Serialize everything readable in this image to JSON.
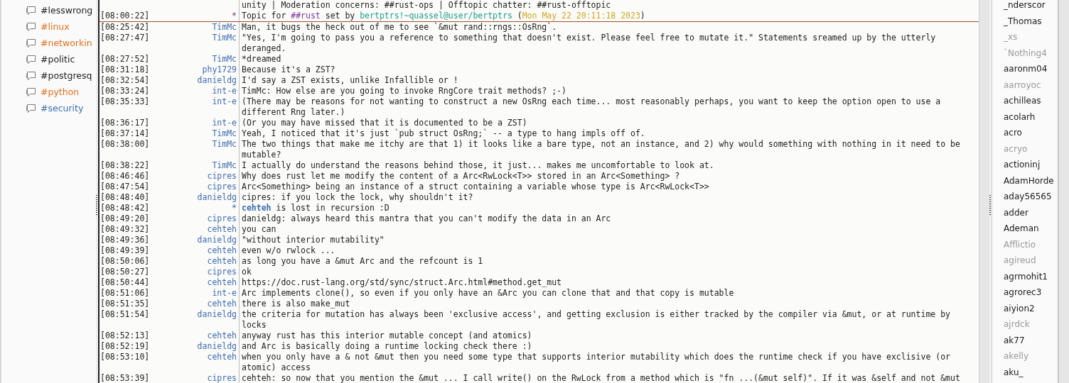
{
  "channels": [
    {
      "name": "#lesswrong",
      "color": "#1e1e1e"
    },
    {
      "name": "#linux",
      "color": "#e0701c"
    },
    {
      "name": "#networkin",
      "color": "#e0701c"
    },
    {
      "name": "#politic",
      "color": "#1e1e1e"
    },
    {
      "name": "#postgresq",
      "color": "#1e1e1e"
    },
    {
      "name": "#python",
      "color": "#e0701c"
    },
    {
      "name": "#security",
      "color": "#3a70b0"
    }
  ],
  "messages": [
    {
      "kind": "continuation",
      "text": "unity | Moderation concerns: ##rust-ops | Offtopic chatter: ##rust-offtopic"
    },
    {
      "kind": "topic",
      "time": "[08:00:22]",
      "sender": "*",
      "read_marker": true,
      "parts": [
        {
          "kind": "plain",
          "text": "Topic for "
        },
        {
          "kind": "channel",
          "text": "##rust"
        },
        {
          "kind": "plain",
          "text": " set by "
        },
        {
          "kind": "host",
          "text": "bertptrs!~quassel@user/bertptrs"
        },
        {
          "kind": "plain",
          "text": " ("
        },
        {
          "kind": "date",
          "text": "Mon May 22 20:11:18 2023"
        },
        {
          "kind": "plain",
          "text": ")"
        }
      ]
    },
    {
      "kind": "message",
      "time": "[08:25:42]",
      "sender": "TimMc",
      "text": "Man, it bugs the heck out of me to see `&mut rand::rngs::OsRng`."
    },
    {
      "kind": "message",
      "time": "[08:27:47]",
      "sender": "TimMc",
      "text": "\"Yes, I'm going to pass you a reference to something that doesn't exist. Please feel free to mutate it.\" Statements sreamed up by the utterly deranged."
    },
    {
      "kind": "message",
      "time": "[08:27:52]",
      "sender": "TimMc",
      "text": "*dreamed"
    },
    {
      "kind": "message",
      "time": "[08:31:18]",
      "sender": "phy1729",
      "text": "Because it's a ZST?"
    },
    {
      "kind": "message",
      "time": "[08:32:54]",
      "sender": "danieldg",
      "text": "I'd say a ZST exists, unlike Infallible or !"
    },
    {
      "kind": "message",
      "time": "[08:33:24]",
      "sender": "int-e",
      "text": "TimMc: How else are you going to invoke RngCore trait methods? ;-)"
    },
    {
      "kind": "message",
      "time": "[08:35:33]",
      "sender": "int-e",
      "text": "(There may be reasons for not wanting to construct a new OsRng each time... most reasonably perhaps, you want to keep the option open to use a different Rng later.)"
    },
    {
      "kind": "message",
      "time": "[08:36:17]",
      "sender": "int-e",
      "text": "(Or you may have missed that it is documented to be a ZST)"
    },
    {
      "kind": "message",
      "time": "[08:37:14]",
      "sender": "TimMc",
      "text": "Yeah, I noticed that it's just `pub struct OsRng;` -- a type to hang impls off of."
    },
    {
      "kind": "message",
      "time": "[08:38:00]",
      "sender": "TimMc",
      "text": "The two things that make me itchy are that 1) it looks like a bare type, not an instance, and 2) why would something with nothing in it need to be mutable?"
    },
    {
      "kind": "message",
      "time": "[08:38:22]",
      "sender": "TimMc",
      "text": "I actually do understand the reasons behind those, it just... makes me uncomfortable to look at."
    },
    {
      "kind": "message",
      "time": "[08:46:46]",
      "sender": "cipres",
      "text": "Why does rust let me modify the content of a Arc<RwLock<T>> stored in an Arc<Something> ?"
    },
    {
      "kind": "message",
      "time": "[08:47:54]",
      "sender": "cipres",
      "text": "Arc<Something> being an instance of a struct containing a variable whose type is Arc<RwLock<T>>"
    },
    {
      "kind": "message",
      "time": "[08:48:40]",
      "sender": "danieldg",
      "text": "cipres: if you lock the lock, why shouldn't it?"
    },
    {
      "kind": "action",
      "time": "[08:48:42]",
      "sender": "*",
      "parts": [
        {
          "kind": "nick",
          "text": "cehteh"
        },
        {
          "kind": "plain",
          "text": " is lost in recursion :D"
        }
      ]
    },
    {
      "kind": "message",
      "time": "[08:49:20]",
      "sender": "cipres",
      "text": "danieldg: always heard this mantra that you can't modify the data in an Arc"
    },
    {
      "kind": "message",
      "time": "[08:49:32]",
      "sender": "cehteh",
      "text": "you can"
    },
    {
      "kind": "message",
      "time": "[08:49:36]",
      "sender": "danieldg",
      "text": "\"without interior mutability\""
    },
    {
      "kind": "message",
      "time": "[08:49:39]",
      "sender": "cehteh",
      "text": "even w/o rwlock ..."
    },
    {
      "kind": "message",
      "time": "[08:50:06]",
      "sender": "cehteh",
      "text": "as long you have a &mut Arc and the refcount is 1"
    },
    {
      "kind": "message",
      "time": "[08:50:27]",
      "sender": "cipres",
      "text": "ok"
    },
    {
      "kind": "message",
      "time": "[08:50:44]",
      "sender": "cehteh",
      "text": "https://doc.rust-lang.org/std/sync/struct.Arc.html#method.get_mut"
    },
    {
      "kind": "message",
      "time": "[08:51:06]",
      "sender": "int-e",
      "text": "Arc implements clone(), so even if you only have an &Arc you can clone that and that copy is mutable"
    },
    {
      "kind": "message",
      "time": "[08:51:35]",
      "sender": "cehteh",
      "text": "there is also make_mut"
    },
    {
      "kind": "message",
      "time": "[08:51:54]",
      "sender": "danieldg",
      "text": "the criteria for mutation has always been 'exclusive access', and getting exclusion is either tracked by the compiler via &mut, or at runtime by locks"
    },
    {
      "kind": "message",
      "time": "[08:52:13]",
      "sender": "cehteh",
      "text": "anyway rust has this interior mutable concept (and atomics)"
    },
    {
      "kind": "message",
      "time": "[08:52:19]",
      "sender": "danieldg",
      "text": "and Arc is basically doing a runtime locking check there :)"
    },
    {
      "kind": "message",
      "time": "[08:53:10]",
      "sender": "cehteh",
      "text": "when you only have a & not &mut then you need some type that supports interior mutability which does the runtime check if you have exclisive (or atomic) access"
    },
    {
      "kind": "message",
      "time": "[08:53:39]",
      "sender": "cipres",
      "text": "cehteh: so now that you mention the &mut ... I call write() on the RwLock from a method which is \"fn ...(&mut self)\". If it was &self and not &mut"
    }
  ],
  "nicks": [
    {
      "name": "_nderscor",
      "away": false
    },
    {
      "name": "_Thomas",
      "away": false
    },
    {
      "name": "_xs",
      "away": true
    },
    {
      "name": "`Nothing4",
      "away": true
    },
    {
      "name": "aaronm04",
      "away": false
    },
    {
      "name": "aarroyoc",
      "away": true
    },
    {
      "name": "achilleas",
      "away": false
    },
    {
      "name": "acolarh",
      "away": false
    },
    {
      "name": "acro",
      "away": false
    },
    {
      "name": "acryo",
      "away": true
    },
    {
      "name": "actioninj",
      "away": false
    },
    {
      "name": "AdamHorde",
      "away": false
    },
    {
      "name": "aday56565",
      "away": false
    },
    {
      "name": "adder",
      "away": false
    },
    {
      "name": "Ademan",
      "away": false
    },
    {
      "name": "Afflictio",
      "away": true
    },
    {
      "name": "agireud",
      "away": true
    },
    {
      "name": "agrmohit1",
      "away": false
    },
    {
      "name": "agrorec3",
      "away": false
    },
    {
      "name": "aiyion2",
      "away": false
    },
    {
      "name": "ajrdck",
      "away": true
    },
    {
      "name": "ak77",
      "away": false
    },
    {
      "name": "akelly",
      "away": true
    },
    {
      "name": "aku_",
      "away": false
    }
  ]
}
